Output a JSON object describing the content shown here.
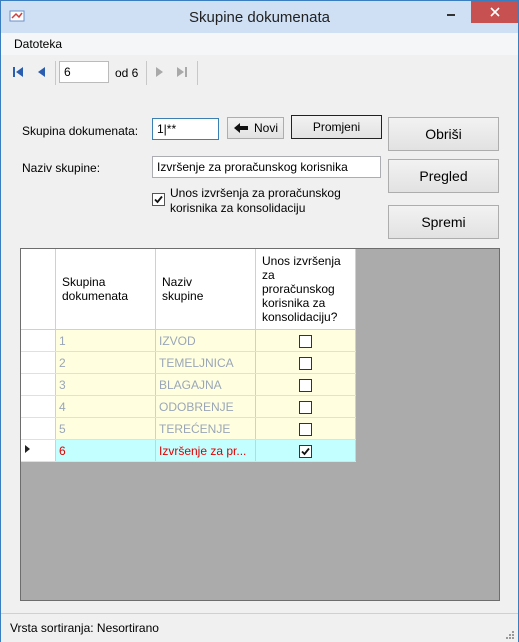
{
  "window": {
    "title": "Skupine dokumenata"
  },
  "menu": {
    "file": "Datoteka"
  },
  "navigator": {
    "position": "6",
    "of_label": "od 6"
  },
  "form": {
    "skupina_label": "Skupina dokumenata:",
    "skupina_value": "1|**",
    "novi_label": "Novi",
    "promjeni_label": "Promjeni",
    "naziv_label": "Naziv skupine:",
    "naziv_value": "Izvršenje za proračunskog korisnika",
    "checkbox_line1": "Unos izvršenja za proračunskog",
    "checkbox_line2": "korisnika za konsolidaciju",
    "checkbox_checked": true
  },
  "buttons": {
    "obrisi": "Obriši",
    "pregled": "Pregled",
    "spremi": "Spremi"
  },
  "grid": {
    "headers": {
      "col1_line1": "Skupina",
      "col1_line2": "dokumenata",
      "col2_line1": "Naziv",
      "col2_line2": "skupine",
      "col3_line1": "Unos izvršenja",
      "col3_line2": "za",
      "col3_line3": "proračunskog",
      "col3_line4": "korisnika za",
      "col3_line5": "konsolidaciju?"
    },
    "rows": [
      {
        "id": "1",
        "name": "IZVOD",
        "checked": false
      },
      {
        "id": "2",
        "name": "TEMELJNICA",
        "checked": false
      },
      {
        "id": "3",
        "name": "BLAGAJNA",
        "checked": false
      },
      {
        "id": "4",
        "name": "ODOBRENJE",
        "checked": false
      },
      {
        "id": "5",
        "name": "TEREĆENJE",
        "checked": false
      },
      {
        "id": "6",
        "name": "Izvršenje za pr...",
        "checked": true
      }
    ]
  },
  "status": {
    "sort_label": "Vrsta sortiranja: Nesortirano"
  },
  "colors": {
    "selected_row": "#c4ffff",
    "row_bg": "#ffffe0",
    "selected_text": "#e00000",
    "faded_text": "#9aa6b8"
  }
}
